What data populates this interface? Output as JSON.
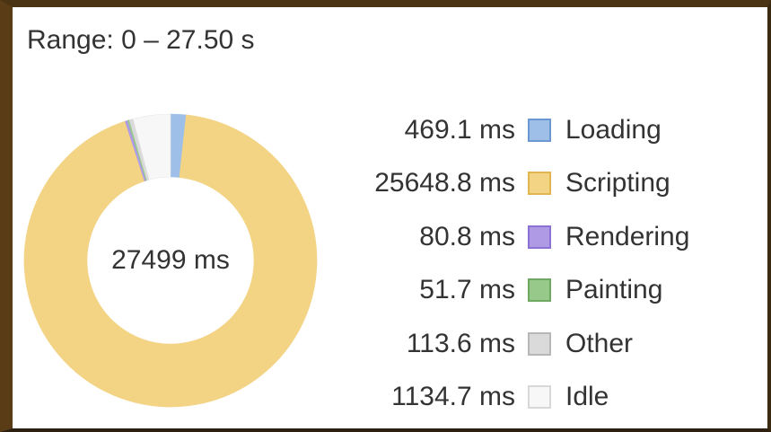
{
  "header": {
    "range_text": "Range: 0 – 27.50 s"
  },
  "chart_data": {
    "type": "pie",
    "center_label": "27499 ms",
    "unit": "ms",
    "slices": [
      {
        "label": "Loading",
        "value": 469.1,
        "value_text": "469.1 ms",
        "color": "#9ebfe8",
        "border": "#6b98d3"
      },
      {
        "label": "Scripting",
        "value": 25648.8,
        "value_text": "25648.8 ms",
        "color": "#f3d384",
        "border": "#e2b64f"
      },
      {
        "label": "Rendering",
        "value": 80.8,
        "value_text": "80.8 ms",
        "color": "#af9ae6",
        "border": "#8d72d6"
      },
      {
        "label": "Painting",
        "value": 51.7,
        "value_text": "51.7 ms",
        "color": "#96c98a",
        "border": "#6ea861"
      },
      {
        "label": "Other",
        "value": 113.6,
        "value_text": "113.6 ms",
        "color": "#dadada",
        "border": "#b7b7b7"
      },
      {
        "label": "Idle",
        "value": 1134.7,
        "value_text": "1134.7 ms",
        "color": "#f7f7f7",
        "border": "#d8d8d8"
      }
    ]
  }
}
